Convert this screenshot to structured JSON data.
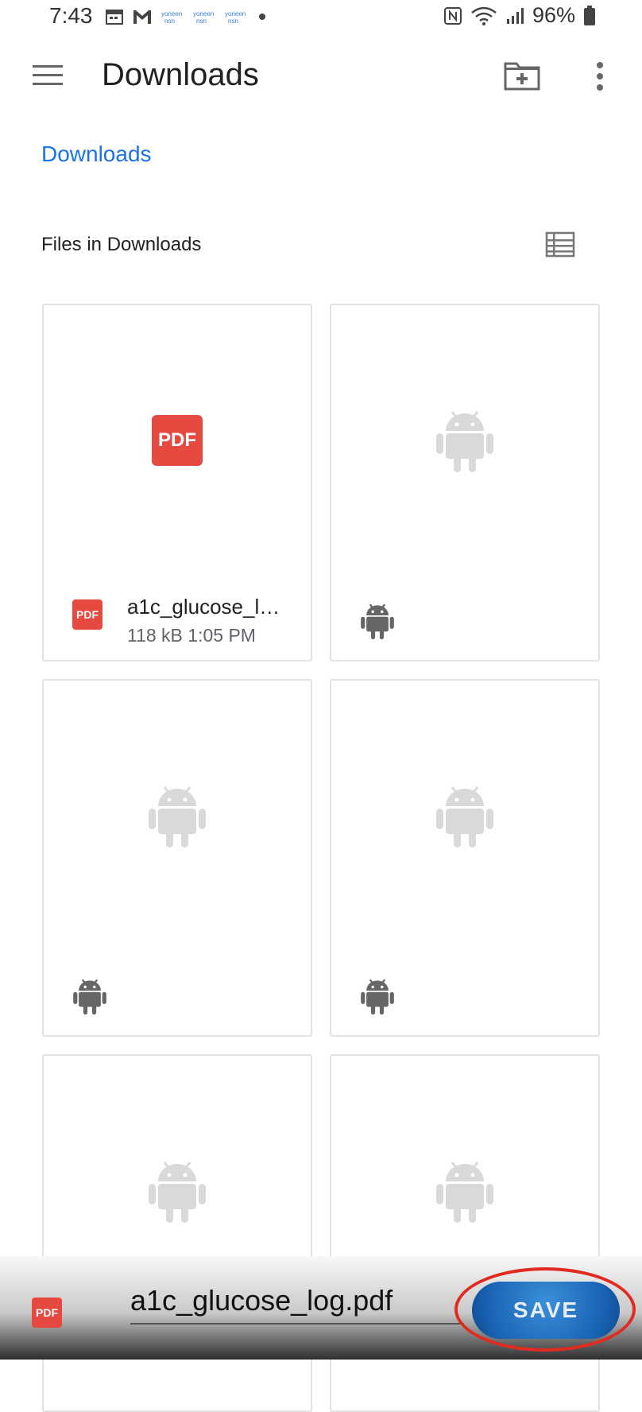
{
  "status_bar": {
    "time": "7:43",
    "battery": "96%",
    "icons": [
      "calendar-icon",
      "gmail-icon",
      "notification-icon",
      "notification-icon",
      "notification-icon",
      "dot-icon",
      "nfc-icon",
      "wifi-icon",
      "signal-icon",
      "battery-icon"
    ]
  },
  "toolbar": {
    "title": "Downloads",
    "menu_icon": "hamburger-menu-icon",
    "new_folder_icon": "new-folder-icon",
    "more_icon": "more-vert-icon"
  },
  "breadcrumb": "Downloads",
  "section": {
    "title": "Files in Downloads",
    "view_icon": "list-view-icon"
  },
  "files": [
    {
      "name": "a1c_glucose_l…",
      "meta": "118 kB 1:05 PM",
      "type": "pdf",
      "thumb_label": "PDF",
      "small_label": "PDF"
    },
    {
      "name": "",
      "meta": "",
      "type": "apk"
    },
    {
      "name": "",
      "meta": "",
      "type": "apk"
    },
    {
      "name": "",
      "meta": "",
      "type": "apk"
    },
    {
      "name": "",
      "meta": "",
      "type": "apk"
    },
    {
      "name": "",
      "meta": "",
      "type": "apk"
    }
  ],
  "save_bar": {
    "filename": "a1c_glucose_log.pdf",
    "file_icon_label": "PDF",
    "save_label": "SAVE"
  },
  "colors": {
    "accent": "#1a73e8",
    "pdf_red": "#e5493f",
    "save_button": "#1a63b5",
    "highlight": "#e12a20"
  }
}
